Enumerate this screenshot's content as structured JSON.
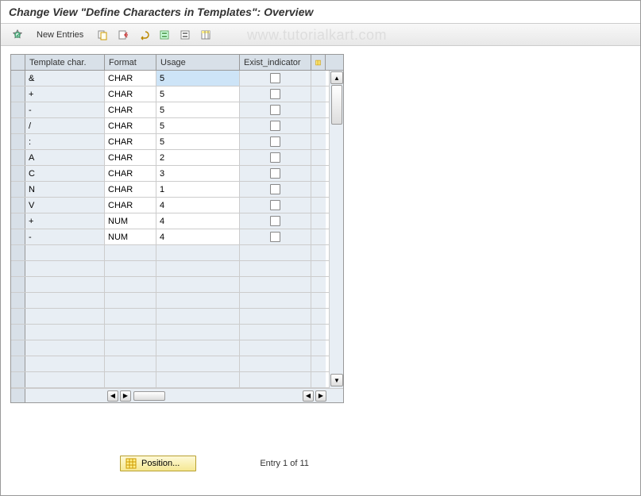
{
  "title": "Change View \"Define Characters in Templates\": Overview",
  "watermark": "www.tutorialkart.com",
  "toolbar": {
    "new_entries": "New Entries"
  },
  "columns": {
    "template_char": "Template char.",
    "format": "Format",
    "usage": "Usage",
    "exist_indicator": "Exist_indicator"
  },
  "rows": [
    {
      "template_char": "&",
      "format": "CHAR",
      "usage": "5",
      "exist": false,
      "selected": true
    },
    {
      "template_char": "+",
      "format": "CHAR",
      "usage": "5",
      "exist": false
    },
    {
      "template_char": "-",
      "format": "CHAR",
      "usage": "5",
      "exist": false
    },
    {
      "template_char": "/",
      "format": "CHAR",
      "usage": "5",
      "exist": false
    },
    {
      "template_char": ":",
      "format": "CHAR",
      "usage": "5",
      "exist": false
    },
    {
      "template_char": "A",
      "format": "CHAR",
      "usage": "2",
      "exist": false
    },
    {
      "template_char": "C",
      "format": "CHAR",
      "usage": "3",
      "exist": false
    },
    {
      "template_char": "N",
      "format": "CHAR",
      "usage": "1",
      "exist": false
    },
    {
      "template_char": "V",
      "format": "CHAR",
      "usage": "4",
      "exist": false
    },
    {
      "template_char": "+",
      "format": "NUM",
      "usage": "4",
      "exist": false
    },
    {
      "template_char": "-",
      "format": "NUM",
      "usage": "4",
      "exist": false
    }
  ],
  "empty_rows": 9,
  "footer": {
    "position": "Position...",
    "entry_status": "Entry 1 of 11"
  }
}
